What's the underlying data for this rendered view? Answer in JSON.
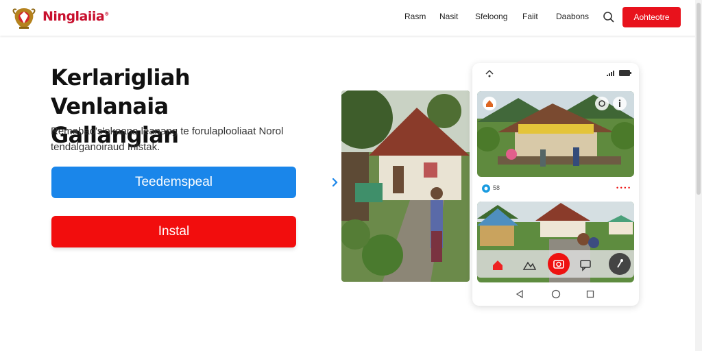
{
  "header": {
    "brand": "Ninglaiia",
    "brand_mark": "®",
    "nav": [
      "Rasm",
      "Nasit",
      "Sfeloong",
      "Faiit",
      "Daabons"
    ],
    "cta": "Aohteotre"
  },
  "hero": {
    "headline_line1": "Kerlarigliah Venlanaia",
    "headline_line2": "Gallangian",
    "sub_line1": "Remabao's'okaana leanang te forulaplooliaat Norol",
    "sub_line2": "tendalganoiraud Inlstak.",
    "primary_button": "Teedemspeal",
    "secondary_button": "Instal"
  },
  "phone": {
    "meta_count": "58",
    "meta_dots": "• • • •"
  },
  "colors": {
    "brand_red": "#c8102e",
    "button_red": "#f20d0d",
    "button_blue": "#1a86ea",
    "cta_red": "#e8121c"
  },
  "icons": [
    "logo-emblem",
    "search-icon",
    "arrow-right-icon",
    "home-icon",
    "mountain-icon",
    "camera-icon",
    "chat-icon",
    "mic-icon",
    "back-icon",
    "home-circle-icon",
    "recents-icon",
    "signal-icon",
    "battery-icon",
    "wifi-icon"
  ]
}
